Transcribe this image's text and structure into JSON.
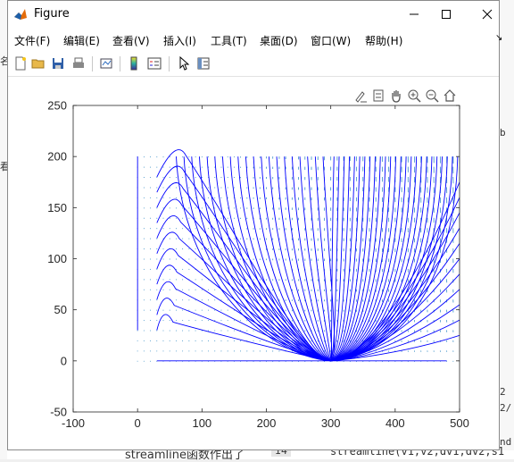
{
  "window": {
    "title": "Figure",
    "menus": [
      "文件(F)",
      "编辑(E)",
      "查看(V)",
      "插入(I)",
      "工具(T)",
      "桌面(D)",
      "窗口(W)",
      "帮助(H)"
    ],
    "toolbar_icons": [
      "new-figure-icon",
      "open-file-icon",
      "save-icon",
      "print-icon",
      "link-plot-icon",
      "insert-colorbar-icon",
      "insert-legend-icon",
      "pointer-icon",
      "property-inspector-icon"
    ],
    "axes_toolbar_icons": [
      "brush-icon",
      "data-tips-icon",
      "pan-icon",
      "zoom-in-icon",
      "zoom-out-icon",
      "home-icon"
    ]
  },
  "background": {
    "left_fragments": [
      "名",
      "看"
    ],
    "right_fragments": [
      "b",
      "2",
      "2/",
      "nd"
    ],
    "bottom_text": "streamline函数作出了",
    "bottom_badge": "14",
    "bottom_code": "streamline(v1,v2,dv1,dv2,s1"
  },
  "chart_data": {
    "type": "streamline + quiver",
    "title": "",
    "xlabel": "",
    "ylabel": "",
    "xlim": [
      -100,
      500
    ],
    "ylim": [
      -50,
      250
    ],
    "xticks": [
      -100,
      0,
      100,
      200,
      300,
      400,
      500
    ],
    "yticks": [
      -50,
      0,
      50,
      100,
      150,
      200,
      250
    ],
    "grid": false,
    "quiver_region": {
      "x": [
        0,
        500
      ],
      "y": [
        0,
        200
      ]
    },
    "streamline_color": "#0000ff",
    "quiver_color": "#3a8fc7",
    "equilibrium_x": 300,
    "baseline_x_range": [
      30,
      480
    ],
    "vertical_line_x": 0,
    "vertical_line_y_range": [
      30,
      200
    ]
  }
}
